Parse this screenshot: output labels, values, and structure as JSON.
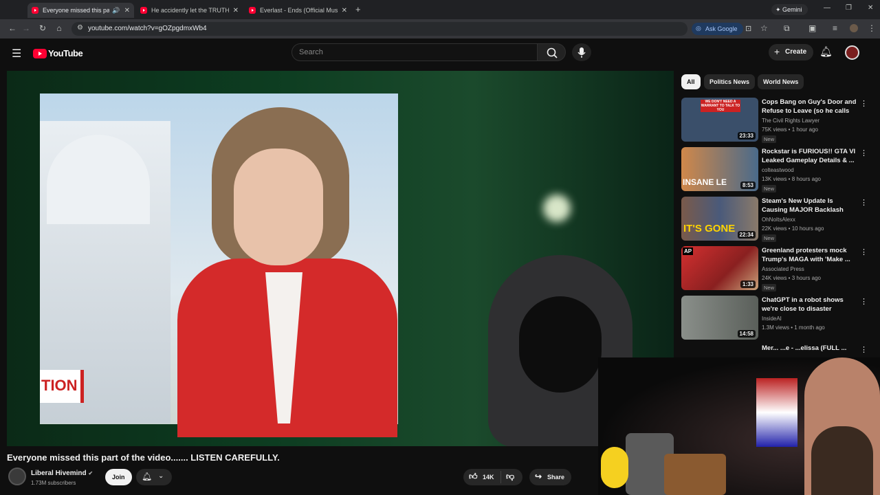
{
  "browser": {
    "tabs": [
      {
        "title": "Everyone missed this part o",
        "active": true
      },
      {
        "title": "He accidently let the TRUTH SL",
        "active": false
      },
      {
        "title": "Everlast - Ends (Official Music V",
        "active": false
      }
    ],
    "new_tab": "+",
    "gemini_label": "Gemini",
    "url": "youtube.com/watch?v=gOZpgdmxWb4",
    "ask_google": "Ask Google"
  },
  "youtube": {
    "logo_text": "YouTube",
    "search_placeholder": "Search",
    "create_label": "Create"
  },
  "player": {
    "lower_third_text": "TION"
  },
  "video": {
    "title": "Everyone missed this part of the video....... LISTEN CAREFULLY.",
    "channel": "Liberal Hivemind",
    "subscribers": "1.73M subscribers",
    "join_label": "Join",
    "likes": "14K",
    "share_label": "Share"
  },
  "chips": [
    "All",
    "Politics News",
    "World News"
  ],
  "recommendations": [
    {
      "title": "Cops Bang on Guy's Door and Refuse to Leave (so he calls th...",
      "channel": "The Civil Rights Lawyer",
      "meta": "75K views • 1 hour ago",
      "badge": "New",
      "duration": "23:33",
      "thumb_text": "WE DON'T NEED A WARRANT TO TALK TO YOU",
      "color": "#3a4f6a"
    },
    {
      "title": "Rockstar is FURIOUS!! GTA VI Leaked Gameplay Details & ...",
      "channel": "colteastwood",
      "meta": "13K views • 8 hours ago",
      "badge": "New",
      "duration": "8:53",
      "thumb_text": "INSANE LE",
      "color": "#b86a3a"
    },
    {
      "title": "Steam's New Update Is Causing MAJOR Backlash",
      "channel": "OhNoItsAlexx",
      "meta": "22K views • 10 hours ago",
      "badge": "New",
      "duration": "22:34",
      "thumb_text": "IT'S GONE",
      "color": "#4a5a7a"
    },
    {
      "title": "Greenland protesters mock Trump's MAGA with 'Make ...",
      "channel": "Associated Press",
      "meta": "24K views • 3 hours ago",
      "badge": "New",
      "duration": "1:33",
      "thumb_text": "AP",
      "color": "#b52a2a"
    },
    {
      "title": "ChatGPT in a robot shows we're close to disaster",
      "channel": "InsideAI",
      "meta": "1.3M views • 1 month ago",
      "badge": "",
      "duration": "14:58",
      "thumb_text": "",
      "color": "#6a6f6a"
    },
    {
      "title": "Mer... ...e - ...elissa (FULL ...",
      "channel": "",
      "meta": "",
      "badge": "",
      "duration": "",
      "thumb_text": "",
      "color": "#1a1a1a"
    }
  ]
}
